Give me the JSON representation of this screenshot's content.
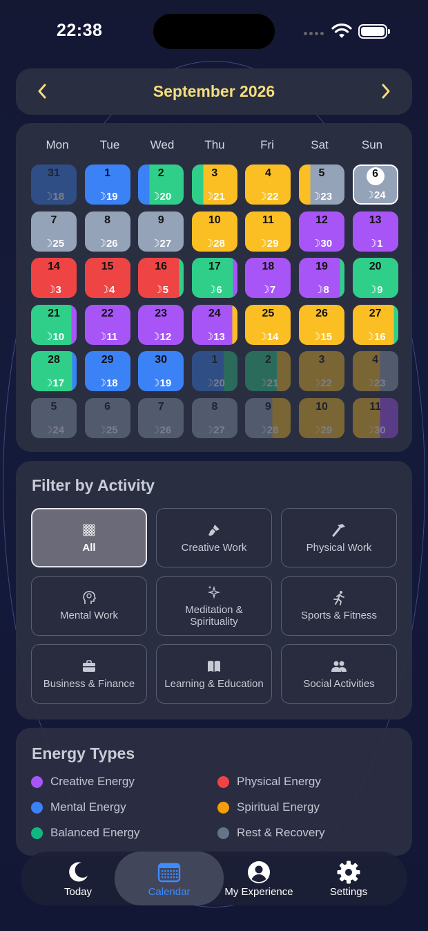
{
  "status_bar": {
    "time": "22:38"
  },
  "header": {
    "month_title": "September 2026"
  },
  "calendar": {
    "weekdays": [
      "Mon",
      "Tue",
      "Wed",
      "Thu",
      "Fri",
      "Sat",
      "Sun"
    ],
    "days": [
      {
        "day": "31",
        "lunar": "☽18",
        "colors": [
          "#3b82f6"
        ],
        "dim": true
      },
      {
        "day": "1",
        "lunar": "☽19",
        "colors": [
          "#3b82f6"
        ]
      },
      {
        "day": "2",
        "lunar": "☽20",
        "colors": [
          "#3b82f6",
          "#2fcf8a",
          "#2fcf8a",
          "#2fcf8a"
        ]
      },
      {
        "day": "3",
        "lunar": "☽21",
        "colors": [
          "#2fcf8a",
          "#fbbf24",
          "#fbbf24",
          "#fbbf24"
        ]
      },
      {
        "day": "4",
        "lunar": "☽22",
        "colors": [
          "#fbbf24"
        ]
      },
      {
        "day": "5",
        "lunar": "☽23",
        "colors": [
          "#fbbf24",
          "#94a3b8",
          "#94a3b8",
          "#94a3b8"
        ]
      },
      {
        "day": "6",
        "lunar": "☽24",
        "colors": [
          "#94a3b8"
        ],
        "today": true
      },
      {
        "day": "7",
        "lunar": "☽25",
        "colors": [
          "#94a3b8"
        ]
      },
      {
        "day": "8",
        "lunar": "☽26",
        "colors": [
          "#94a3b8"
        ]
      },
      {
        "day": "9",
        "lunar": "☽27",
        "colors": [
          "#94a3b8"
        ]
      },
      {
        "day": "10",
        "lunar": "☽28",
        "colors": [
          "#fbbf24"
        ]
      },
      {
        "day": "11",
        "lunar": "☽29",
        "colors": [
          "#fbbf24"
        ]
      },
      {
        "day": "12",
        "lunar": "☽30",
        "colors": [
          "#a855f7"
        ]
      },
      {
        "day": "13",
        "lunar": "☽1",
        "colors": [
          "#a855f7"
        ]
      },
      {
        "day": "14",
        "lunar": "☽3",
        "colors": [
          "#ef4444"
        ]
      },
      {
        "day": "15",
        "lunar": "☽4",
        "colors": [
          "#ef4444"
        ]
      },
      {
        "day": "16",
        "lunar": "☽5",
        "colors": [
          "#ef4444",
          "#ef4444",
          "#ef4444",
          "#ef4444",
          "#ef4444",
          "#ef4444",
          "#ef4444",
          "#ef4444",
          "#ef4444",
          "#2fcf8a"
        ]
      },
      {
        "day": "17",
        "lunar": "☽6",
        "colors": [
          "#2fcf8a",
          "#2fcf8a",
          "#2fcf8a",
          "#2fcf8a",
          "#2fcf8a",
          "#2fcf8a",
          "#2fcf8a",
          "#2fcf8a",
          "#2fcf8a",
          "#a855f7"
        ]
      },
      {
        "day": "18",
        "lunar": "☽7",
        "colors": [
          "#a855f7"
        ]
      },
      {
        "day": "19",
        "lunar": "☽8",
        "colors": [
          "#a855f7",
          "#a855f7",
          "#a855f7",
          "#a855f7",
          "#a855f7",
          "#a855f7",
          "#a855f7",
          "#a855f7",
          "#a855f7",
          "#2fcf8a"
        ]
      },
      {
        "day": "20",
        "lunar": "☽9",
        "colors": [
          "#2fcf8a"
        ]
      },
      {
        "day": "21",
        "lunar": "☽10",
        "colors": [
          "#2fcf8a",
          "#2fcf8a",
          "#2fcf8a",
          "#2fcf8a",
          "#2fcf8a",
          "#2fcf8a",
          "#2fcf8a",
          "#2fcf8a",
          "#a855f7"
        ]
      },
      {
        "day": "22",
        "lunar": "☽11",
        "colors": [
          "#a855f7"
        ]
      },
      {
        "day": "23",
        "lunar": "☽12",
        "colors": [
          "#a855f7"
        ]
      },
      {
        "day": "24",
        "lunar": "☽13",
        "colors": [
          "#a855f7",
          "#a855f7",
          "#a855f7",
          "#a855f7",
          "#a855f7",
          "#a855f7",
          "#a855f7",
          "#a855f7",
          "#fbbf24"
        ]
      },
      {
        "day": "25",
        "lunar": "☽14",
        "colors": [
          "#fbbf24"
        ]
      },
      {
        "day": "26",
        "lunar": "☽15",
        "colors": [
          "#fbbf24"
        ]
      },
      {
        "day": "27",
        "lunar": "☽16",
        "colors": [
          "#fbbf24",
          "#fbbf24",
          "#fbbf24",
          "#fbbf24",
          "#fbbf24",
          "#fbbf24",
          "#fbbf24",
          "#fbbf24",
          "#fbbf24",
          "#2fcf8a"
        ]
      },
      {
        "day": "28",
        "lunar": "☽17",
        "colors": [
          "#2fcf8a",
          "#2fcf8a",
          "#2fcf8a",
          "#2fcf8a",
          "#2fcf8a",
          "#2fcf8a",
          "#2fcf8a",
          "#2fcf8a",
          "#2fcf8a",
          "#3b82f6"
        ]
      },
      {
        "day": "29",
        "lunar": "☽18",
        "colors": [
          "#3b82f6"
        ]
      },
      {
        "day": "30",
        "lunar": "☽19",
        "colors": [
          "#3b82f6"
        ]
      },
      {
        "day": "1",
        "lunar": "☽20",
        "colors": [
          "#3b82f6",
          "#3b82f6",
          "#3b82f6",
          "#3b82f6",
          "#3b82f6",
          "#3b82f6",
          "#3b82f6",
          "#2fcf8a",
          "#2fcf8a",
          "#2fcf8a"
        ],
        "dim": true
      },
      {
        "day": "2",
        "lunar": "☽21",
        "colors": [
          "#2fcf8a",
          "#2fcf8a",
          "#2fcf8a",
          "#2fcf8a",
          "#2fcf8a",
          "#2fcf8a",
          "#2fcf8a",
          "#fbbf24",
          "#fbbf24",
          "#fbbf24"
        ],
        "dim": true
      },
      {
        "day": "3",
        "lunar": "☽22",
        "colors": [
          "#fbbf24"
        ],
        "dim": true
      },
      {
        "day": "4",
        "lunar": "☽23",
        "colors": [
          "#fbbf24",
          "#fbbf24",
          "#fbbf24",
          "#fbbf24",
          "#fbbf24",
          "#fbbf24",
          "#94a3b8",
          "#94a3b8",
          "#94a3b8",
          "#94a3b8"
        ],
        "dim": true
      },
      {
        "day": "5",
        "lunar": "☽24",
        "colors": [
          "#94a3b8"
        ],
        "dim": true
      },
      {
        "day": "6",
        "lunar": "☽25",
        "colors": [
          "#94a3b8"
        ],
        "dim": true
      },
      {
        "day": "7",
        "lunar": "☽26",
        "colors": [
          "#94a3b8"
        ],
        "dim": true
      },
      {
        "day": "8",
        "lunar": "☽27",
        "colors": [
          "#94a3b8"
        ],
        "dim": true
      },
      {
        "day": "9",
        "lunar": "☽28",
        "colors": [
          "#94a3b8",
          "#94a3b8",
          "#94a3b8",
          "#94a3b8",
          "#94a3b8",
          "#94a3b8",
          "#fbbf24",
          "#fbbf24",
          "#fbbf24",
          "#fbbf24"
        ],
        "dim": true
      },
      {
        "day": "10",
        "lunar": "☽29",
        "colors": [
          "#fbbf24"
        ],
        "dim": true
      },
      {
        "day": "11",
        "lunar": "☽30",
        "colors": [
          "#fbbf24",
          "#fbbf24",
          "#fbbf24",
          "#fbbf24",
          "#fbbf24",
          "#fbbf24",
          "#a855f7",
          "#a855f7",
          "#a855f7",
          "#a855f7"
        ],
        "dim": true
      }
    ]
  },
  "filter": {
    "title": "Filter by Activity",
    "options": [
      {
        "label": "All",
        "icon": "grid-icon",
        "active": true
      },
      {
        "label": "Creative Work",
        "icon": "paintbrush-icon"
      },
      {
        "label": "Physical Work",
        "icon": "hammer-icon"
      },
      {
        "label": "Mental Work",
        "icon": "brain-head-icon"
      },
      {
        "label": "Meditation & Spirituality",
        "icon": "sparkles-icon"
      },
      {
        "label": "Sports & Fitness",
        "icon": "running-figure-icon"
      },
      {
        "label": "Business & Finance",
        "icon": "briefcase-icon"
      },
      {
        "label": "Learning & Education",
        "icon": "book-icon"
      },
      {
        "label": "Social Activities",
        "icon": "people-icon"
      }
    ]
  },
  "energy": {
    "title": "Energy Types",
    "items": [
      {
        "label": "Creative Energy",
        "color": "#a855f7"
      },
      {
        "label": "Physical Energy",
        "color": "#ef4444"
      },
      {
        "label": "Mental Energy",
        "color": "#3b82f6"
      },
      {
        "label": "Spiritual Energy",
        "color": "#f59e0b"
      },
      {
        "label": "Balanced Energy",
        "color": "#10b981"
      },
      {
        "label": "Rest & Recovery",
        "color": "#64748b"
      }
    ]
  },
  "tabbar": {
    "tabs": [
      {
        "label": "Today",
        "icon": "moon-icon"
      },
      {
        "label": "Calendar",
        "icon": "calendar-icon",
        "active": true
      },
      {
        "label": "My Experience",
        "icon": "person-circle-icon"
      },
      {
        "label": "Settings",
        "icon": "gear-icon"
      }
    ]
  },
  "colors": {
    "accent": "#f4de7c",
    "tab_active": "#3d8bff"
  }
}
